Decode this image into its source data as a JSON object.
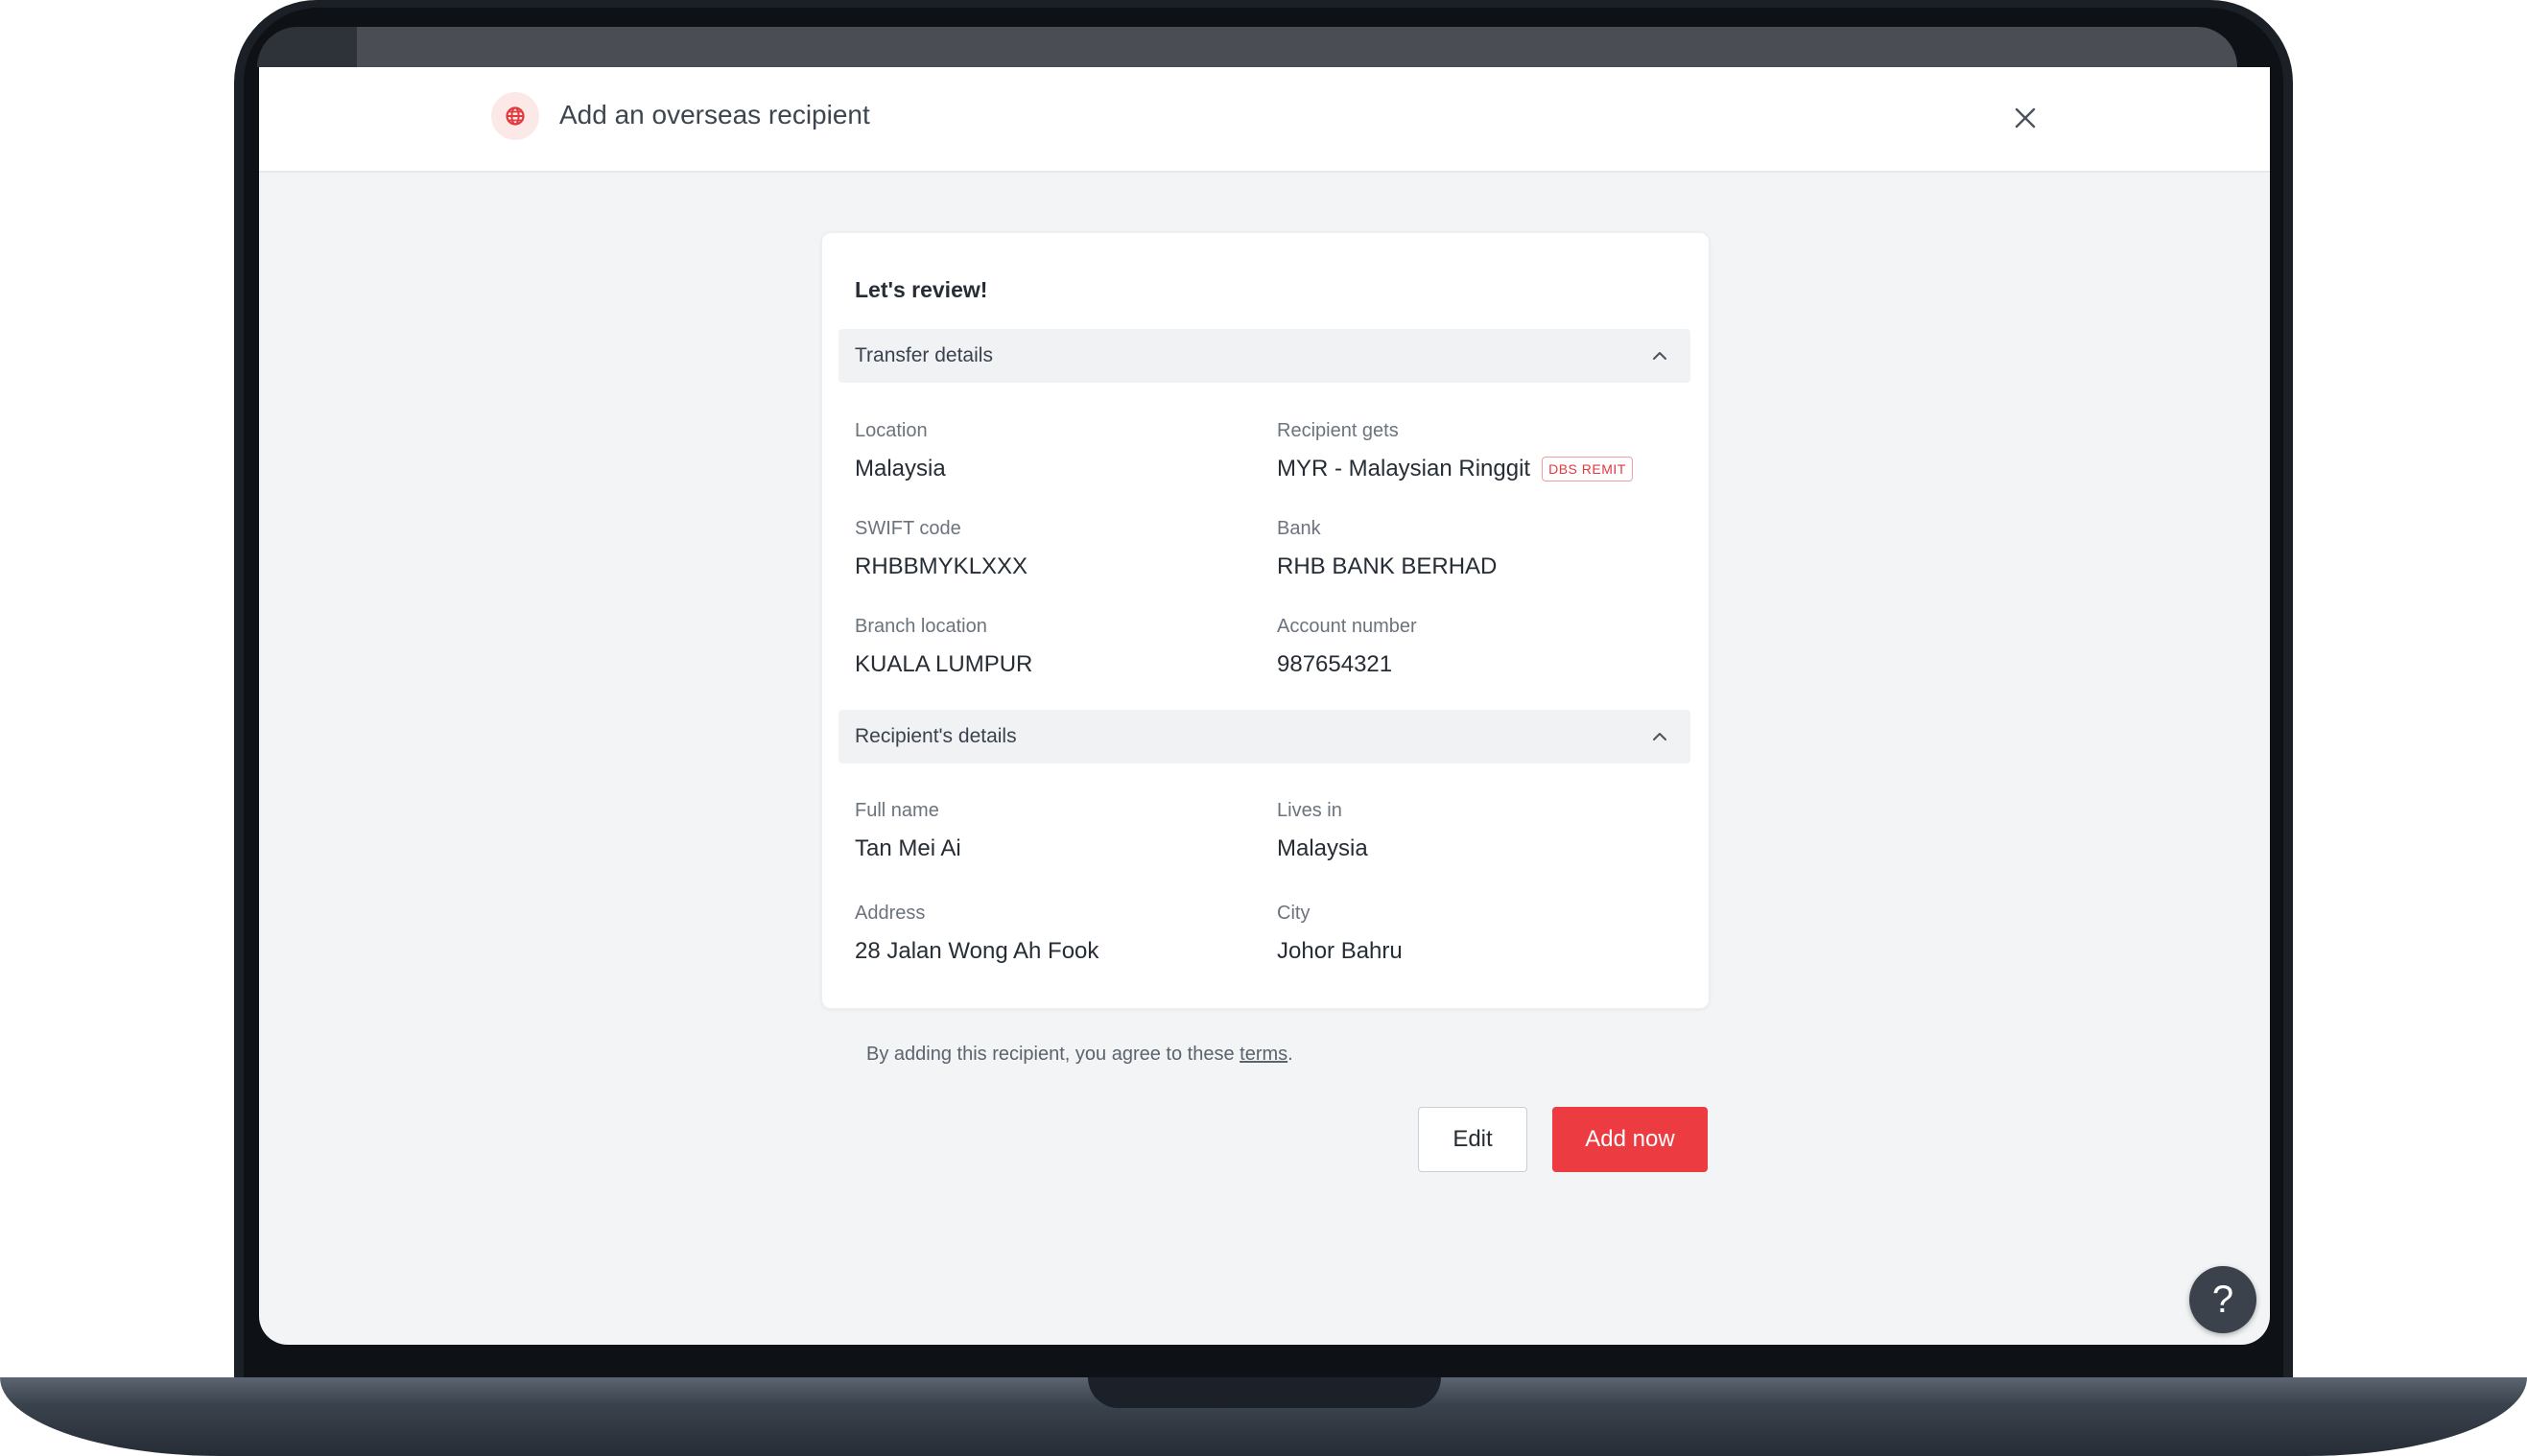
{
  "header": {
    "title": "Add an overseas recipient",
    "icon": "globe-icon",
    "close_icon": "close-icon"
  },
  "review": {
    "title": "Let's review!",
    "transfer_section": {
      "label": "Transfer details",
      "location_label": "Location",
      "location_value": "Malaysia",
      "recipient_gets_label": "Recipient gets",
      "recipient_gets_value": "MYR - Malaysian Ringgit",
      "recipient_gets_badge": "DBS REMIT",
      "swift_label": "SWIFT code",
      "swift_value": "RHBBMYKLXXX",
      "bank_label": "Bank",
      "bank_value": "RHB BANK BERHAD",
      "branch_label": "Branch location",
      "branch_value": "KUALA LUMPUR",
      "account_label": "Account number",
      "account_value": "987654321"
    },
    "recipient_section": {
      "label": "Recipient's details",
      "fullname_label": "Full name",
      "fullname_value": "Tan Mei Ai",
      "lives_label": "Lives in",
      "lives_value": "Malaysia",
      "address_label": "Address",
      "address_value": "28 Jalan Wong Ah Fook",
      "city_label": "City",
      "city_value": "Johor Bahru"
    }
  },
  "terms": {
    "prefix": "By adding this recipient, you agree to these ",
    "link": "terms",
    "suffix": "."
  },
  "actions": {
    "edit_label": "Edit",
    "add_label": "Add now"
  },
  "help": {
    "label": "?"
  },
  "colors": {
    "accent": "#ec3c41",
    "background": "#f3f4f6",
    "text": "#262d35"
  }
}
